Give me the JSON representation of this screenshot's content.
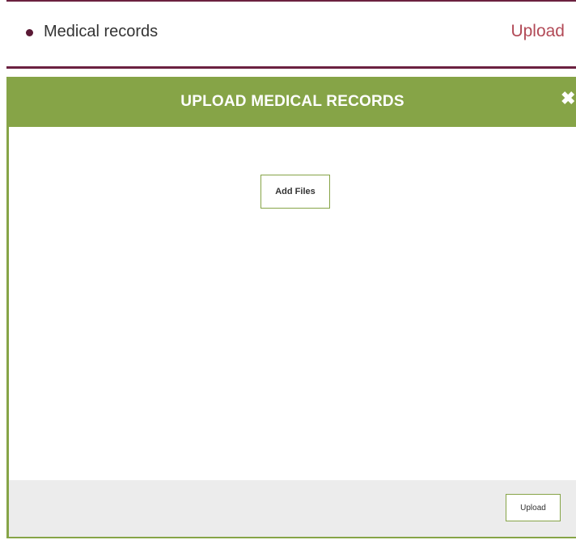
{
  "records_row": {
    "label": "Medical records",
    "action_label": "Upload"
  },
  "modal": {
    "title": "UPLOAD MEDICAL RECORDS",
    "close_icon": "close-icon",
    "add_files_label": "Add Files",
    "upload_label": "Upload"
  },
  "colors": {
    "accent_green": "#86a447",
    "maroon_rule": "#6b2140",
    "link_red": "#b24a57",
    "footer_gray": "#ececec"
  }
}
